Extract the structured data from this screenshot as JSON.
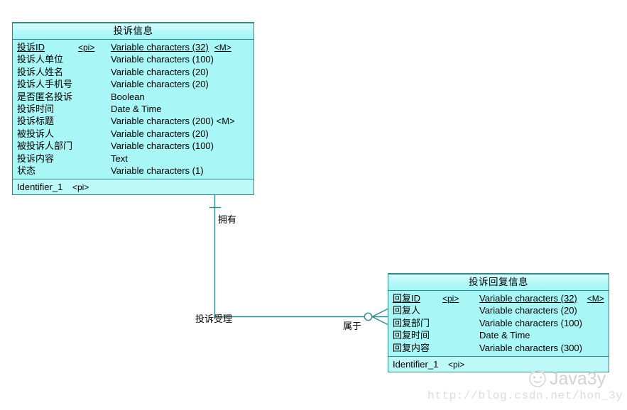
{
  "diagram": {
    "type": "entity-relationship-diagram",
    "background_color": "#ffffff",
    "entity_fill_color": "#aaf7f7",
    "entity_border_color": "#2e8b8b",
    "connector_color": "#2e8b8b"
  },
  "entities": [
    {
      "id": "complaint",
      "title": "投诉信息",
      "attributes": [
        {
          "name": "投诉ID",
          "pi": "<pi>",
          "type": "Variable characters (32)",
          "mandatory": "<M>",
          "primary": true
        },
        {
          "name": "投诉人单位",
          "pi": "",
          "type": "Variable characters (100)",
          "mandatory": "",
          "primary": false
        },
        {
          "name": "投诉人姓名",
          "pi": "",
          "type": "Variable characters (20)",
          "mandatory": "",
          "primary": false
        },
        {
          "name": "投诉人手机号",
          "pi": "",
          "type": "Variable characters (20)",
          "mandatory": "",
          "primary": false
        },
        {
          "name": "是否匿名投诉",
          "pi": "",
          "type": "Boolean",
          "mandatory": "",
          "primary": false
        },
        {
          "name": "投诉时间",
          "pi": "",
          "type": "Date & Time",
          "mandatory": "",
          "primary": false
        },
        {
          "name": "投诉标题",
          "pi": "",
          "type": "Variable characters (200) <M>",
          "mandatory": "",
          "primary": false
        },
        {
          "name": "被投诉人",
          "pi": "",
          "type": "Variable characters (20)",
          "mandatory": "",
          "primary": false
        },
        {
          "name": "被投诉人部门",
          "pi": "",
          "type": "Variable characters (100)",
          "mandatory": "",
          "primary": false
        },
        {
          "name": "投诉内容",
          "pi": "",
          "type": "Text",
          "mandatory": "",
          "primary": false
        },
        {
          "name": "状态",
          "pi": "",
          "type": "Variable characters (1)",
          "mandatory": "",
          "primary": false
        }
      ],
      "identifier": {
        "label": "Identifier_1",
        "tag": "<pi>"
      }
    },
    {
      "id": "reply",
      "title": "投诉回复信息",
      "attributes": [
        {
          "name": "回复ID",
          "pi": "<pi>",
          "type": "Variable characters (32)",
          "mandatory": "<M>",
          "primary": true
        },
        {
          "name": "回复人",
          "pi": "",
          "type": "Variable characters (20)",
          "mandatory": "",
          "primary": false
        },
        {
          "name": "回复部门",
          "pi": "",
          "type": "Variable characters (100)",
          "mandatory": "",
          "primary": false
        },
        {
          "name": "回复时间",
          "pi": "",
          "type": "Date & Time",
          "mandatory": "",
          "primary": false
        },
        {
          "name": "回复内容",
          "pi": "",
          "type": "Variable characters (300)",
          "mandatory": "",
          "primary": false
        }
      ],
      "identifier": {
        "label": "Identifier_1",
        "tag": "<pi>"
      }
    }
  ],
  "relationships": [
    {
      "id": "owns",
      "label": "拥有",
      "from": "complaint",
      "to": "reply"
    },
    {
      "id": "accept",
      "label": "投诉受理",
      "from": "complaint",
      "to": "reply"
    },
    {
      "id": "belong",
      "label": "属于",
      "from": "reply",
      "to": "complaint"
    }
  ],
  "watermark": {
    "logo_icon": "smiley-face-icon",
    "logo_text": "Java3y",
    "url": "http://blog.csdn.net/hon_3y"
  }
}
